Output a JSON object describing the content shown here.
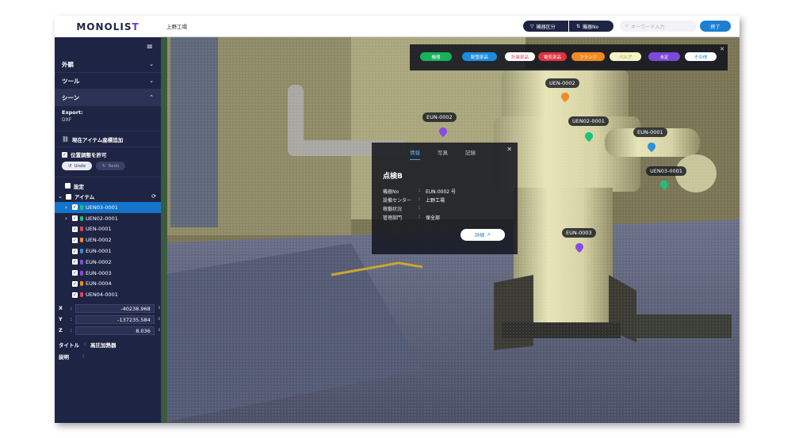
{
  "app": {
    "logo": "MONOLIS",
    "logo_suffix": "T"
  },
  "sidebar": {
    "menu_icon": "hamburger-icon",
    "menus": [
      {
        "label": "外観"
      },
      {
        "label": "ツール"
      },
      {
        "label": "シーン"
      }
    ],
    "export_label": "Export:",
    "export_value": "DXF",
    "add_item_label": "現在アイテム座標追加",
    "allow_adjust_label": "位置調整を許可",
    "undo_label": "Undo",
    "redo_label": "Redo",
    "settings_label": "設定",
    "items_label": "アイテム",
    "items": [
      {
        "label": "UEN03-0001",
        "color": "#1fc07a",
        "selected": true,
        "expandable": true
      },
      {
        "label": "UEN02-0001",
        "color": "#1fc07a",
        "selected": false,
        "expandable": true
      },
      {
        "label": "UEN-0001",
        "color": "#e0445a",
        "selected": false,
        "expandable": false
      },
      {
        "label": "UEN-0002",
        "color": "#f08a22",
        "selected": false,
        "expandable": false
      },
      {
        "label": "EUN-0001",
        "color": "#2f8fe0",
        "selected": false,
        "expandable": false
      },
      {
        "label": "EUN-0002",
        "color": "#8a4be0",
        "selected": false,
        "expandable": false
      },
      {
        "label": "EUN-0003",
        "color": "#8a4be0",
        "selected": false,
        "expandable": false
      },
      {
        "label": "EUN-0004",
        "color": "#f08a22",
        "selected": false,
        "expandable": false
      },
      {
        "label": "UEN04-0001",
        "color": "#e0445a",
        "selected": false,
        "expandable": false
      }
    ],
    "coords": [
      {
        "axis": "X",
        "value": "-40238.968"
      },
      {
        "axis": "Y",
        "value": "-137235.584"
      },
      {
        "axis": "Z",
        "value": "8.036"
      }
    ],
    "title_label": "タイトル",
    "title_value": "高圧加熱器",
    "desc_label": "説明",
    "desc_value": ""
  },
  "topbar": {
    "scene_title": "上野工場",
    "filter_button": "機器区分",
    "id_button": "機器No",
    "search_placeholder": "キーワード入力",
    "end_button": "終了"
  },
  "filters": [
    {
      "label": "機器",
      "bg": "#17b25a",
      "fg": "#ffffff"
    },
    {
      "label": "配管部品",
      "bg": "#1a8de0",
      "fg": "#ffffff"
    },
    {
      "label": "計装部品",
      "bg": "#ffffff",
      "fg": "#e0445a"
    },
    {
      "label": "電気部品",
      "bg": "#e0343f",
      "fg": "#ffffff"
    },
    {
      "label": "フランジ",
      "bg": "#f08a22",
      "fg": "#ffffff"
    },
    {
      "label": "バルブ",
      "bg": "#f3f3c8",
      "fg": "#9aa020"
    },
    {
      "label": "未定",
      "bg": "#7b48d9",
      "fg": "#ffffff"
    },
    {
      "label": "その他",
      "bg": "#ffffff",
      "fg": "#1d7fd1"
    }
  ],
  "markers": [
    {
      "label": "EUN-0002",
      "color": "#8a4be0"
    },
    {
      "label": "UEN-0002",
      "color": "#f08a22"
    },
    {
      "label": "UEN02-0001",
      "color": "#1fc07a"
    },
    {
      "label": "EUN-0001",
      "color": "#2f8fe0"
    },
    {
      "label": "UEN03-0001",
      "color": "#1fc07a"
    },
    {
      "label": "EUN-0003",
      "color": "#8a4be0"
    }
  ],
  "popup": {
    "tabs": [
      "情報",
      "写真",
      "記録"
    ],
    "title": "点検B",
    "rows": [
      {
        "key": "機器No",
        "value": "EUN-0002 号"
      },
      {
        "key": "設備センター",
        "value": "上野工場"
      },
      {
        "key": "稼働状況",
        "value": ""
      },
      {
        "key": "管理部門",
        "value": "保全部"
      }
    ],
    "detail_button": "詳細"
  }
}
